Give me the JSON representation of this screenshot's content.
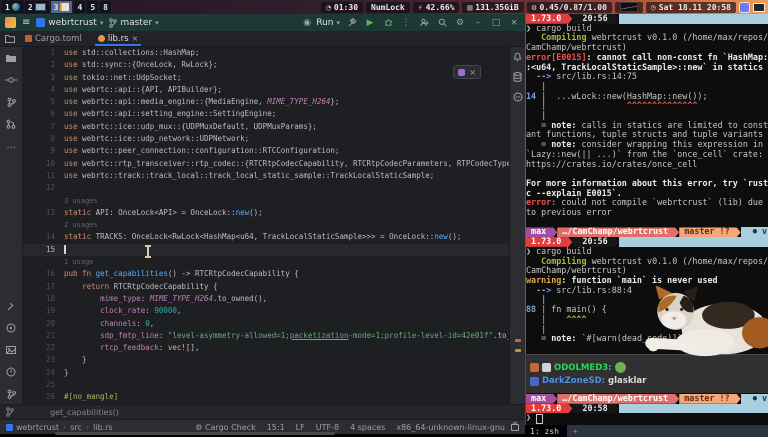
{
  "topbar": {
    "workspaces": [
      {
        "label": "1",
        "icon": "globe",
        "active": false
      },
      {
        "label": "2",
        "icon": "monitor",
        "active": false
      },
      {
        "label": "3",
        "icon": "edit",
        "active": true
      },
      {
        "label": "4",
        "active": false
      },
      {
        "label": "5",
        "active": false
      },
      {
        "label": "8",
        "active": false
      }
    ],
    "status_items": [
      {
        "name": "timer",
        "icon": "activity",
        "text": "01:30"
      },
      {
        "name": "numlock",
        "text": "NumLock"
      },
      {
        "name": "battery",
        "icon": "bolt",
        "text": "42.66%"
      },
      {
        "name": "disk",
        "icon": "disk",
        "text": "131.35GiB"
      },
      {
        "name": "load",
        "icon": "load",
        "text": "0.45/0.87/1.00"
      },
      {
        "name": "cpu-graph",
        "icon": "graph",
        "text": ""
      },
      {
        "name": "date",
        "icon": "clock",
        "text": "Sat 18.11 20:58"
      }
    ],
    "tray": [
      {
        "icon": "discord"
      },
      {
        "icon": "display"
      }
    ]
  },
  "ide": {
    "header": {
      "project": "webrtcrust",
      "branch": "master",
      "run": "Run"
    },
    "tabs": [
      {
        "label": "Cargo.toml",
        "active": false
      },
      {
        "label": "lib.rs",
        "active": true
      }
    ],
    "editor": {
      "rows": [
        {
          "n": "1",
          "t": [
            [
              "k",
              "use"
            ],
            [
              "d",
              " std::collections::HashMap;"
            ]
          ]
        },
        {
          "n": "2",
          "t": [
            [
              "k",
              "use"
            ],
            [
              "d",
              " std::sync::{OnceLock, RwLock};"
            ]
          ]
        },
        {
          "n": "3",
          "t": [
            [
              "k",
              "use"
            ],
            [
              "d",
              " tokio::net::UdpSocket;"
            ]
          ]
        },
        {
          "n": "4",
          "t": [
            [
              "k",
              "use"
            ],
            [
              "d",
              " webrtc::api::{API, APIBuilder};"
            ]
          ]
        },
        {
          "n": "5",
          "t": [
            [
              "k",
              "use"
            ],
            [
              "d",
              " webrtc::api::media_engine::{MediaEngine, "
            ],
            [
              "c",
              "MIME_TYPE_H264"
            ],
            [
              "d",
              "};"
            ]
          ]
        },
        {
          "n": "6",
          "t": [
            [
              "k",
              "use"
            ],
            [
              "d",
              " webrtc::api::setting_engine::SettingEngine;"
            ]
          ]
        },
        {
          "n": "7",
          "t": [
            [
              "k",
              "use"
            ],
            [
              "d",
              " webrtc::ice::udp_mux::{UDPMuxDefault, UDPMuxParams};"
            ]
          ]
        },
        {
          "n": "8",
          "t": [
            [
              "k",
              "use"
            ],
            [
              "d",
              " webrtc::ice::udp_network::UDPNetwork;"
            ]
          ]
        },
        {
          "n": "9",
          "t": [
            [
              "k",
              "use"
            ],
            [
              "d",
              " webrtc::peer_connection::configuration::RTCConfiguration;"
            ]
          ]
        },
        {
          "n": "10",
          "t": [
            [
              "k",
              "use"
            ],
            [
              "d",
              " webrtc::rtp_transceiver::rtp_codec::{RTCRtpCodecCapability, RTCRtpCodecParameters, RTPCodecType};"
            ]
          ]
        },
        {
          "n": "11",
          "t": [
            [
              "k",
              "use"
            ],
            [
              "d",
              " webrtc::track::track_local::track_local_static_sample::TrackLocalStaticSample;"
            ]
          ]
        },
        {
          "n": "12",
          "t": []
        },
        {
          "hint": "3 usages"
        },
        {
          "n": "13",
          "t": [
            [
              "k",
              "static"
            ],
            [
              "d",
              " API: OnceLock<API> = OnceLock::"
            ],
            [
              "fn",
              "new"
            ],
            [
              "d",
              "();"
            ]
          ]
        },
        {
          "hint": "2 usages"
        },
        {
          "n": "14",
          "t": [
            [
              "k",
              "static"
            ],
            [
              "d",
              " TRACKS: OnceLock<RwLock<HashMap<u64, TrackLocalStaticSample>>> = OnceLock::"
            ],
            [
              "fn",
              "new"
            ],
            [
              "d",
              "();"
            ]
          ]
        },
        {
          "n": "15",
          "cur": true,
          "t": []
        },
        {
          "hint": "1 usage"
        },
        {
          "n": "16",
          "t": [
            [
              "k",
              "pub fn "
            ],
            [
              "fn",
              "get_capabilities"
            ],
            [
              "d",
              "() -> RTCRtpCodecCapability {"
            ]
          ]
        },
        {
          "n": "17",
          "t": [
            [
              "d",
              "    "
            ],
            [
              "k",
              "return"
            ],
            [
              "d",
              " RTCRtpCodecCapability {"
            ]
          ]
        },
        {
          "n": "18",
          "t": [
            [
              "d",
              "        "
            ],
            [
              "f",
              "mime_type"
            ],
            [
              "d",
              ": "
            ],
            [
              "c",
              "MIME_TYPE_H264"
            ],
            [
              "d",
              ".to_owned(),"
            ]
          ]
        },
        {
          "n": "19",
          "t": [
            [
              "d",
              "        "
            ],
            [
              "f",
              "clock_rate"
            ],
            [
              "d",
              ": "
            ],
            [
              "n",
              "90000"
            ],
            [
              "d",
              ","
            ]
          ]
        },
        {
          "n": "20",
          "t": [
            [
              "d",
              "        "
            ],
            [
              "f",
              "channels"
            ],
            [
              "d",
              ": "
            ],
            [
              "n",
              "0"
            ],
            [
              "d",
              ","
            ]
          ]
        },
        {
          "n": "21",
          "t": [
            [
              "d",
              "        "
            ],
            [
              "f",
              "sdp_fmtp_line"
            ],
            [
              "d",
              ": "
            ],
            [
              "s",
              "\"level-asymmetry-allowed=1;"
            ],
            [
              "su",
              "packetization"
            ],
            [
              "s",
              "-mode=1;profile-level-id=42e01f\""
            ],
            [
              "d",
              ".to_owned(),"
            ]
          ]
        },
        {
          "n": "22",
          "t": [
            [
              "d",
              "        "
            ],
            [
              "f",
              "rtcp_feedback"
            ],
            [
              "d",
              ": "
            ],
            [
              "m",
              "vec!"
            ],
            [
              "d",
              "[],"
            ]
          ]
        },
        {
          "n": "23",
          "t": [
            [
              "d",
              "    }"
            ]
          ]
        },
        {
          "n": "24",
          "t": [
            [
              "d",
              "}"
            ]
          ]
        },
        {
          "n": "25",
          "t": []
        },
        {
          "n": "26",
          "t": [
            [
              "a",
              "#[no_mangle]"
            ]
          ]
        }
      ]
    },
    "context_line": "get_capabilities()",
    "statusbar": {
      "breadcrumb": [
        "webrtcrust",
        "src",
        "lib.rs"
      ],
      "right": [
        "Cargo Check",
        "15:1",
        "LF",
        "UTF-8",
        "4 spaces",
        "x86_64-unknown-linux-gnu"
      ]
    }
  },
  "terminal1": {
    "lines": [
      {
        "prompt": [
          [
            "red",
            " 1.73.0 "
          ],
          [
            "dark",
            "  20:56 "
          ]
        ],
        "right": ""
      },
      {
        "seg": [
          [
            "d",
            "❯ cargo build"
          ]
        ]
      },
      {
        "seg": [
          [
            "d",
            "   "
          ],
          [
            "grn",
            "Compiling"
          ],
          [
            "d",
            " webrtcrust v0.1.0 (/home/max/repos/"
          ]
        ]
      },
      {
        "seg": [
          [
            "d",
            "CamChamp/webrtcrust)"
          ]
        ]
      },
      {
        "seg": [
          [
            "err",
            "error[E0015]"
          ],
          [
            "b",
            ": cannot call non-const fn `HashMap:"
          ]
        ]
      },
      {
        "seg": [
          [
            "b",
            ":<u64, TrackLocalStaticSample>::new` in statics"
          ]
        ]
      },
      {
        "seg": [
          [
            "blu",
            "  --> "
          ],
          [
            "d",
            "src/lib.rs:14:75"
          ]
        ]
      },
      {
        "seg": [
          [
            "blu",
            "   |"
          ]
        ]
      },
      {
        "seg": [
          [
            "blu",
            "14 |"
          ],
          [
            "d",
            "  ...wLock::new(HashMap::new());"
          ]
        ]
      },
      {
        "seg": [
          [
            "blu",
            "   |"
          ],
          [
            "rc",
            "                ^^^^^^^^^^^^^^"
          ]
        ]
      },
      {
        "seg": [
          [
            "blu",
            "   |"
          ]
        ]
      },
      {
        "seg": [
          [
            "blu",
            "   = "
          ],
          [
            "b",
            "note:"
          ],
          [
            "d",
            " calls in statics are limited to const"
          ]
        ]
      },
      {
        "seg": [
          [
            "d",
            "ant functions, tuple structs and tuple variants"
          ]
        ]
      },
      {
        "seg": [
          [
            "blu",
            "   = "
          ],
          [
            "b",
            "note:"
          ],
          [
            "d",
            " consider wrapping this expression in"
          ]
        ]
      },
      {
        "seg": [
          [
            "d",
            "`Lazy::new(|| ...)` from the `once_cell` crate:"
          ]
        ]
      },
      {
        "seg": [
          [
            "d",
            "https://crates.io/crates/once_cell"
          ]
        ]
      },
      {
        "seg": []
      },
      {
        "seg": [
          [
            "b",
            "For more information about this error, try `rust"
          ]
        ]
      },
      {
        "seg": [
          [
            "b",
            "c --explain E0015`."
          ]
        ]
      },
      {
        "seg": [
          [
            "err",
            "error"
          ],
          [
            "d",
            ": could not compile `webrtcrust` (lib) due"
          ]
        ]
      },
      {
        "seg": [
          [
            "d",
            "to previous error"
          ]
        ]
      },
      {
        "seg": []
      },
      {
        "prompt": [
          [
            "purple",
            " max "
          ],
          [
            "pink",
            " …/CamChamp/webrtcrust "
          ],
          [
            "peach",
            " master !? "
          ]
        ],
        "right": "⏺ v"
      },
      {
        "prompt": [
          [
            "red",
            " 1.73.0 "
          ],
          [
            "dark",
            "  20:56 "
          ]
        ],
        "right": ""
      },
      {
        "seg": [
          [
            "d",
            "❯ cargo build"
          ]
        ]
      },
      {
        "seg": [
          [
            "d",
            "   "
          ],
          [
            "grn",
            "Compiling"
          ],
          [
            "d",
            " webrtcrust v0.1.0 (/home/max/repos/"
          ]
        ]
      },
      {
        "seg": [
          [
            "d",
            "CamChamp/webrtcrust)"
          ]
        ]
      },
      {
        "seg": [
          [
            "warn",
            "warning"
          ],
          [
            "b",
            ": function `main` is never used"
          ]
        ]
      },
      {
        "seg": [
          [
            "blu",
            "  --> "
          ],
          [
            "d",
            "src/lib.rs:88:4"
          ]
        ]
      },
      {
        "seg": [
          [
            "blu",
            "   |"
          ]
        ]
      },
      {
        "seg": [
          [
            "blu",
            "88 |"
          ],
          [
            "d",
            " fn main() {"
          ]
        ]
      },
      {
        "seg": [
          [
            "blu",
            "   |"
          ],
          [
            "yc",
            "    ^^^^"
          ]
        ]
      },
      {
        "seg": [
          [
            "blu",
            "   |"
          ]
        ]
      },
      {
        "seg": [
          [
            "blu",
            "   = "
          ],
          [
            "b",
            "note:"
          ],
          [
            "d",
            " `#[warn(dead_code)]` on b"
          ]
        ]
      },
      {
        "seg": []
      }
    ]
  },
  "chat": {
    "messages": [
      {
        "badges": [
          "orange",
          "grey"
        ],
        "user": "ODOLMED3:",
        "user_color": "#27d957",
        "emote": "pepe",
        "text": ""
      },
      {
        "badges": [
          "blue"
        ],
        "user": "DarkZoneSD:",
        "user_color": "#4f8fe8",
        "text": "glasklar"
      }
    ]
  },
  "terminal2": {
    "lines": [
      {
        "prompt": [
          [
            "purple",
            " max "
          ],
          [
            "pink",
            " …/CamChamp/webrtcrust "
          ],
          [
            "peach",
            " master !? "
          ]
        ],
        "right": "⏺ v"
      },
      {
        "prompt": [
          [
            "red",
            " 1.73.0 "
          ],
          [
            "dark",
            "  20:58 "
          ]
        ],
        "right": ""
      },
      {
        "seg": [
          [
            "d",
            "❯ "
          ],
          [
            "cur",
            ""
          ]
        ]
      }
    ]
  },
  "tabbar": {
    "label": "1: zsh",
    "new_tab": "+"
  }
}
